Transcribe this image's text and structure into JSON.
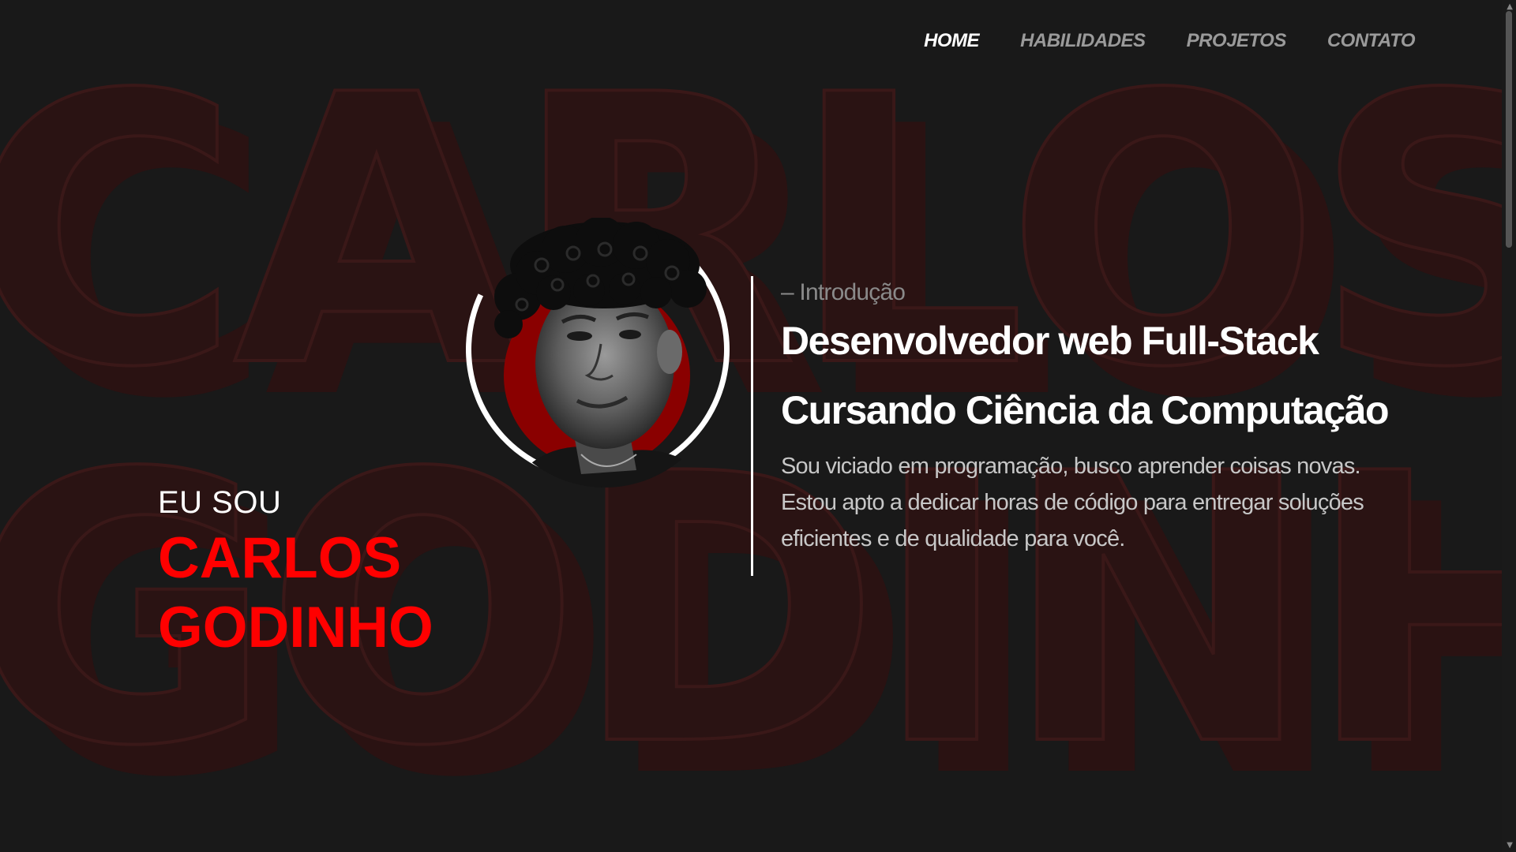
{
  "background": {
    "line1": "CARLOS",
    "line2": "GODINHO"
  },
  "nav": {
    "items": [
      {
        "label": "HOME",
        "active": true
      },
      {
        "label": "HABILIDADES",
        "active": false
      },
      {
        "label": "PROJETOS",
        "active": false
      },
      {
        "label": "CONTATO",
        "active": false
      }
    ]
  },
  "hero": {
    "greeting": "EU SOU",
    "name_first": "CARLOS",
    "name_last": "GODINHO",
    "intro_label": "– Introdução",
    "headline_1": "Desenvolvedor web Full-Stack",
    "headline_2": "Cursando Ciência da Computação",
    "description": "Sou viciado em programação, busco aprender coisas novas. Estou apto a dedicar horas de código para entregar soluções eficientes e de qualidade para você."
  },
  "colors": {
    "background": "#191919",
    "accent": "#ff0000",
    "nav_active": "#ffffff",
    "nav_inactive": "#9a9a9a"
  },
  "icons": {
    "scroll_up": "chevron-up-icon",
    "scroll_down": "chevron-down-icon"
  }
}
